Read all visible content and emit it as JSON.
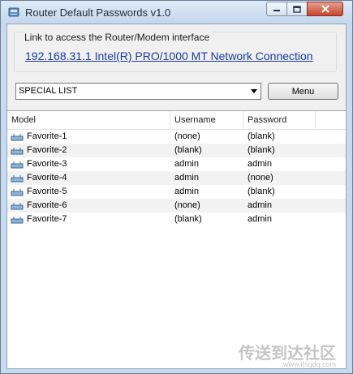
{
  "window": {
    "title": "Router Default Passwords v1.0",
    "controls": [
      "minimize-icon",
      "maximize-icon",
      "close-icon"
    ]
  },
  "link_group": {
    "label": "Link to access the Router/Modem interface",
    "link_text": "192.168.31.1   Intel(R) PRO/1000 MT Network Connection"
  },
  "toolbar": {
    "list_select_value": "SPECIAL LIST",
    "menu_label": "Menu"
  },
  "table": {
    "columns": [
      "Model",
      "Username",
      "Password"
    ],
    "rows": [
      {
        "model": "Favorite-1",
        "username": "(none)",
        "password": "(blank)"
      },
      {
        "model": "Favorite-2",
        "username": "(blank)",
        "password": "(blank)"
      },
      {
        "model": "Favorite-3",
        "username": "admin",
        "password": "admin"
      },
      {
        "model": "Favorite-4",
        "username": "admin",
        "password": "(none)"
      },
      {
        "model": "Favorite-5",
        "username": "admin",
        "password": "(blank)"
      },
      {
        "model": "Favorite-6",
        "username": "(none)",
        "password": "admin"
      },
      {
        "model": "Favorite-7",
        "username": "(blank)",
        "password": "admin"
      }
    ]
  },
  "watermark": {
    "text": "传送到达社区",
    "sub": "www.itsqdq.com"
  },
  "colors": {
    "link": "#1a3a9e",
    "title_bar": "#c7daee",
    "close_button": "#c6452e"
  }
}
